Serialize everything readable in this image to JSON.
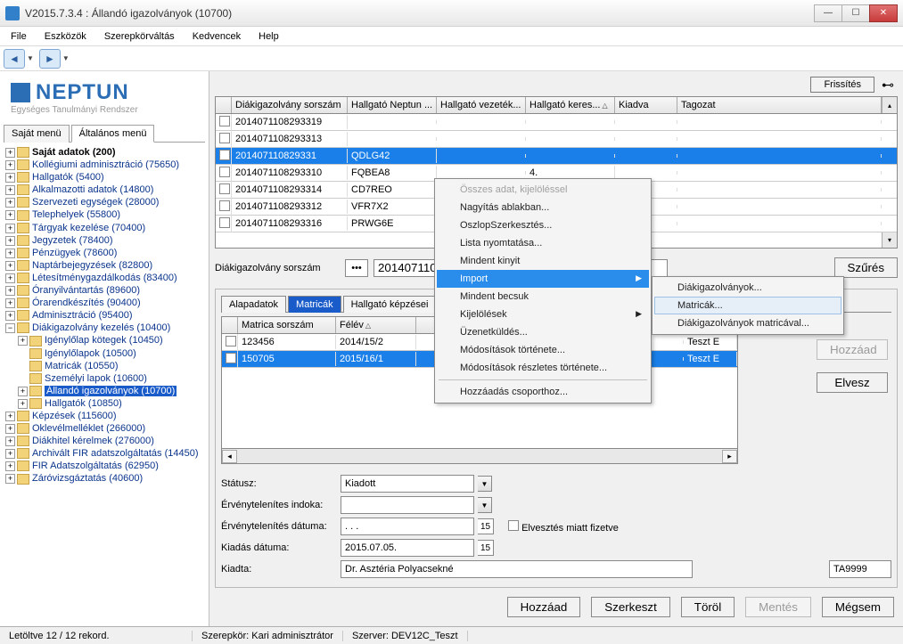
{
  "window": {
    "title": "V2015.7.3.4 : Állandó igazolványok (10700)"
  },
  "menubar": [
    "File",
    "Eszközök",
    "Szerepkörváltás",
    "Kedvencek",
    "Help"
  ],
  "logo": {
    "title": "NEPTUN",
    "subtitle": "Egységes Tanulmányi Rendszer"
  },
  "tree_tabs": {
    "tab1": "Saját menü",
    "tab2": "Általános menü"
  },
  "tree": [
    {
      "label": "Saját adatok  (200)",
      "bold": true,
      "tw": "+"
    },
    {
      "label": "Kollégiumi adminisztráció (75650)",
      "tw": "+"
    },
    {
      "label": "Hallgatók (5400)",
      "tw": "+"
    },
    {
      "label": "Alkalmazotti adatok (14800)",
      "tw": "+"
    },
    {
      "label": "Szervezeti egységek (28000)",
      "tw": "+"
    },
    {
      "label": "Telephelyek (55800)",
      "tw": "+"
    },
    {
      "label": "Tárgyak kezelése (70400)",
      "tw": "+"
    },
    {
      "label": "Jegyzetek (78400)",
      "tw": "+"
    },
    {
      "label": "Pénzügyek (78600)",
      "tw": "+"
    },
    {
      "label": "Naptárbejegyzések (82800)",
      "tw": "+"
    },
    {
      "label": "Létesítménygazdálkodás (83400)",
      "tw": "+"
    },
    {
      "label": "Óranyilvántartás (89600)",
      "tw": "+"
    },
    {
      "label": "Órarendkészítés (90400)",
      "tw": "+"
    },
    {
      "label": "Adminisztráció (95400)",
      "tw": "+"
    },
    {
      "label": "Diákigazolvány kezelés (10400)",
      "tw": "−",
      "children": [
        {
          "label": "Igénylőlap kötegek (10450)",
          "tw": "+"
        },
        {
          "label": "Igénylőlapok (10500)"
        },
        {
          "label": "Matricák (10550)"
        },
        {
          "label": "Személyi lapok (10600)"
        },
        {
          "label": "Állandó igazolványok (10700)",
          "sel": true,
          "tw": "+"
        },
        {
          "label": "Hallgatók (10850)",
          "tw": "+"
        }
      ]
    },
    {
      "label": "Képzések (115600)",
      "tw": "+"
    },
    {
      "label": "Oklevélmelléklet (266000)",
      "tw": "+"
    },
    {
      "label": "Diákhitel kérelmek (276000)",
      "tw": "+"
    },
    {
      "label": "Archivált FIR adatszolgáltatás (14450)",
      "tw": "+"
    },
    {
      "label": "FIR Adatszolgáltatás (62950)",
      "tw": "+"
    },
    {
      "label": "Záróvizsgáztatás (40600)",
      "tw": "+"
    }
  ],
  "top_buttons": {
    "refresh": "Frissítés"
  },
  "grid1": {
    "headers": [
      "",
      "Diákigazolvány sorszám",
      "Hallgató Neptun ...",
      "Hallgató vezeték...",
      "Hallgató keres...",
      "Kiadva",
      "Tagozat"
    ],
    "rows": [
      {
        "c1": "2014071108293319",
        "c2": ""
      },
      {
        "c1": "2014071108293313",
        "c2": ""
      },
      {
        "c1": "201407110829331",
        "c2": "QDLG42",
        "sel": true
      },
      {
        "c1": "2014071108293310",
        "c2": "FQBEA8",
        "c5": "4."
      },
      {
        "c1": "2014071108293314",
        "c2": "CD7REO"
      },
      {
        "c1": "2014071108293312",
        "c2": "VFR7X2"
      },
      {
        "c1": "2014071108293316",
        "c2": "PRWG6E"
      }
    ]
  },
  "filter": {
    "label": "Diákigazolvány sorszám",
    "value": "2014071108293",
    "szures": "Szűrés"
  },
  "sub_tabs": [
    "Alapadatok",
    "Matricák",
    "Hallgató képzései"
  ],
  "grid2": {
    "headers": [
      "",
      "Matrica sorszám",
      "Félév",
      "",
      "Nyomda"
    ],
    "rows": [
      {
        "c1": "123456",
        "c2": "2014/15/2",
        "c4": "Teszt E"
      },
      {
        "c1": "150705",
        "c2": "2015/16/1",
        "c4": "Teszt E",
        "sel": true
      }
    ]
  },
  "side_buttons": {
    "add": "Hozzáad",
    "remove": "Elvesz"
  },
  "form": {
    "status_label": "Státusz:",
    "status_value": "Kiadott",
    "reason_label": "Érvénytelenítes indoka:",
    "inv_date_label": "Érvénytelenítés dátuma:",
    "inv_date_value": ".   .   .",
    "lost_label": "Elvesztés miatt fizetve",
    "issue_date_label": "Kiadás dátuma:",
    "issue_date_value": "2015.07.05.",
    "issuer_label": "Kiadta:",
    "issuer_value": "Dr. Asztéria Polyacsekné",
    "issuer_code": "TA9999"
  },
  "footer_buttons": {
    "add": "Hozzáad",
    "edit": "Szerkeszt",
    "delete": "Töröl",
    "save": "Mentés",
    "cancel": "Mégsem"
  },
  "context_menu": {
    "items": [
      {
        "label": "Összes adat, kijelöléssel",
        "disabled": true
      },
      {
        "label": "Nagyítás ablakban..."
      },
      {
        "label": "OszlopSzerkesztés..."
      },
      {
        "label": "Lista nyomtatása..."
      },
      {
        "label": "Mindent kinyit"
      },
      {
        "label": "Import",
        "sel": true,
        "sub": true
      },
      {
        "label": "Mindent becsuk"
      },
      {
        "label": "Kijelölések",
        "sub": true
      },
      {
        "label": "Üzenetküldés..."
      },
      {
        "label": "Módosítások története..."
      },
      {
        "label": "Módosítások részletes története..."
      },
      {
        "sep": true
      },
      {
        "label": "Hozzáadás csoporthoz..."
      }
    ],
    "submenu": [
      {
        "label": "Diákigazolványok..."
      },
      {
        "label": "Matricák...",
        "hover": true
      },
      {
        "label": "Diákigazolványok matricával..."
      }
    ]
  },
  "statusbar": {
    "records": "Letöltve 12 / 12 rekord.",
    "role": "Szerepkör: Kari adminisztrátor",
    "server": "Szerver: DEV12C_Teszt"
  }
}
